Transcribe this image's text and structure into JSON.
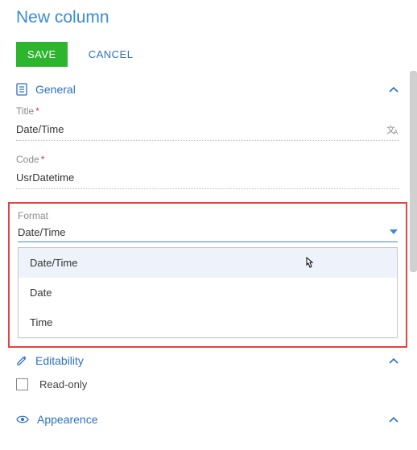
{
  "page": {
    "title": "New column"
  },
  "actions": {
    "save_label": "SAVE",
    "cancel_label": "CANCEL"
  },
  "sections": {
    "general": {
      "label": "General",
      "expanded": true
    },
    "editability": {
      "label": "Editability",
      "expanded": true
    },
    "appearance": {
      "label": "Appearence",
      "expanded": true
    }
  },
  "fields": {
    "title": {
      "label": "Title",
      "required": true,
      "value": "Date/Time"
    },
    "code": {
      "label": "Code",
      "required": true,
      "value": "UsrDatetime"
    },
    "format": {
      "label": "Format",
      "value": "Date/Time",
      "options": [
        "Date/Time",
        "Date",
        "Time"
      ],
      "hovered_index": 0
    },
    "readonly": {
      "label": "Read-only",
      "checked": false
    }
  },
  "colors": {
    "accent": "#3a8bd8",
    "save": "#2db52d",
    "link": "#2a71c2",
    "highlight_border": "#e2443f",
    "dropdown_hover": "#eef3fb"
  }
}
